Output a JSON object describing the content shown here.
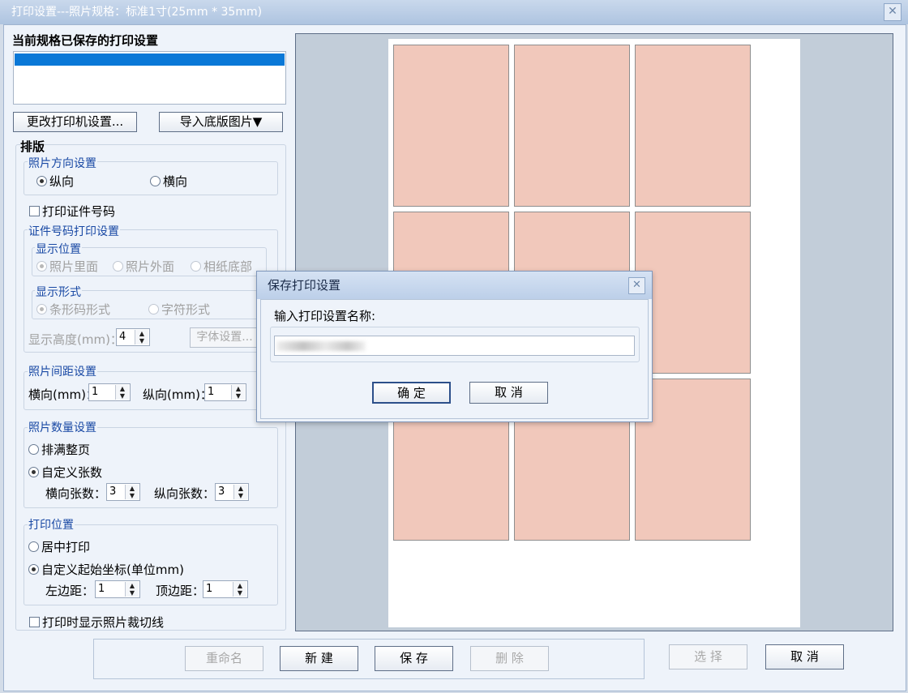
{
  "window": {
    "title": "打印设置---照片规格：标准1寸(25mm * 35mm)",
    "close_glyph": "✕"
  },
  "left": {
    "saved_heading": "当前规格已保存的打印设置",
    "change_printer_button": "更改打印机设置...",
    "import_bg_button": "导入底版图片▼",
    "layout_heading": "排版",
    "orientation": {
      "label": "照片方向设置",
      "portrait": "纵向",
      "landscape": "横向",
      "selected": "portrait"
    },
    "print_id_checkbox": "打印证件号码",
    "id_settings": {
      "label": "证件号码打印设置",
      "position_label": "显示位置",
      "position_inside": "照片里面",
      "position_outside": "照片外面",
      "position_paper_bottom": "相纸底部",
      "format_label": "显示形式",
      "format_barcode": "条形码形式",
      "format_text": "字符形式",
      "height_label": "显示高度(mm)：",
      "height_value": "4",
      "font_button": "字体设置..."
    },
    "spacing": {
      "label": "照片间距设置",
      "horizontal_label": "横向(mm)：",
      "horizontal_value": "1",
      "vertical_label": "纵向(mm)：",
      "vertical_value": "1"
    },
    "quantity": {
      "label": "照片数量设置",
      "fill_page": "排满整页",
      "custom": "自定义张数",
      "h_count_label": "横向张数：",
      "h_count_value": "3",
      "v_count_label": "纵向张数：",
      "v_count_value": "3"
    },
    "position": {
      "label": "打印位置",
      "center": "居中打印",
      "custom": "自定义起始坐标(单位mm)",
      "left_margin_label": "左边距：",
      "left_margin_value": "1",
      "top_margin_label": "顶边距：",
      "top_margin_value": "1"
    },
    "show_cut_lines_checkbox": "打印时显示照片裁切线"
  },
  "bottom": {
    "rename": "重命名",
    "new": "新 建",
    "save": "保 存",
    "delete": "删 除",
    "select": "选 择",
    "cancel": "取 消"
  },
  "dialog": {
    "title": "保存打印设置",
    "prompt": "输入打印设置名称:",
    "ok": "确 定",
    "cancel": "取 消"
  },
  "preview": {
    "photo_count": 9,
    "photo_color": "#f1c8bb"
  },
  "colors": {
    "selection": "#0a78d7",
    "accent_label": "#1848a4"
  }
}
